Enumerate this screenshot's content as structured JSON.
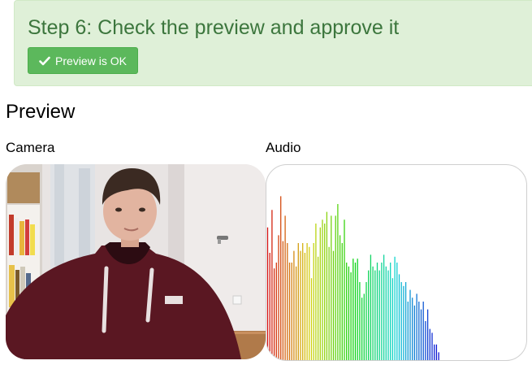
{
  "step": {
    "title": "Step 6: Check the preview and approve it",
    "ok_button_label": "Preview is OK",
    "ok_button_icon": "checkmark-icon"
  },
  "preview": {
    "heading": "Preview",
    "camera_label": "Camera",
    "audio_label": "Audio"
  },
  "colors": {
    "panel_bg": "#dff0d8",
    "panel_text": "#3c763d",
    "button_bg": "#5cb85c"
  },
  "audio_spectrum": {
    "levels": [
      0.68,
      0.55,
      0.77,
      0.47,
      0.5,
      0.64,
      0.84,
      0.61,
      0.74,
      0.6,
      0.5,
      0.5,
      0.56,
      0.48,
      0.6,
      0.56,
      0.6,
      0.55,
      0.6,
      0.58,
      0.42,
      0.6,
      0.7,
      0.53,
      0.68,
      0.72,
      0.7,
      0.76,
      0.58,
      0.74,
      0.56,
      0.74,
      0.8,
      0.64,
      0.6,
      0.72,
      0.5,
      0.48,
      0.45,
      0.52,
      0.5,
      0.52,
      0.4,
      0.32,
      0.34,
      0.4,
      0.46,
      0.54,
      0.48,
      0.46,
      0.5,
      0.46,
      0.5,
      0.54,
      0.48,
      0.46,
      0.5,
      0.42,
      0.53,
      0.5,
      0.44,
      0.4,
      0.38,
      0.4,
      0.3,
      0.36,
      0.32,
      0.28,
      0.34,
      0.3,
      0.26,
      0.3,
      0.2,
      0.26,
      0.16,
      0.14,
      0.08,
      0.08,
      0.04
    ]
  }
}
